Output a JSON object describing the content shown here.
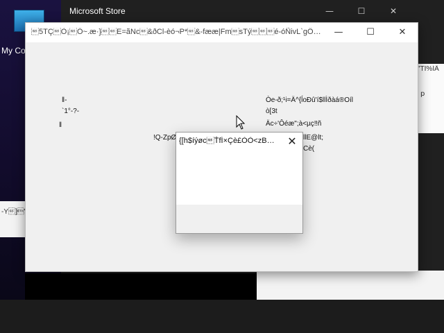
{
  "desktop": {
    "icon_label": "My Co",
    "icon_name": "computer-icon"
  },
  "store_window": {
    "title": "Microsoft Store",
    "right_text_1": "\"TI%ÍÄ",
    "right_text_2": "p",
    "left_text": "-Y\u001d]\u0003\""
  },
  "app_window": {
    "title": "\u001d5TÇ\u001dÒ¡\u001dÖ~.æ·}\u001d\u001dE=ãNc\u001d&ðCl-èó¬P*\u001d&-fææ|Fm\u001dsTý\u001d\u001d\u001dé-óÑivL`gÔ+(!...",
    "left_text_1": "‖-",
    "left_text_2": "`1°-?-",
    "left_text_3": "‖",
    "mid_text": "!Q-ZpØ",
    "right_lines": [
      "Òe-ð;¹i=Ä^{ĺoÐû'í$llÌðàá®Oíl",
      "ò[3t",
      "Äc÷'Ôéæ\";à<µç‼ñ",
      "llE@lt;",
      "Cè("
    ],
    "minimize_label": "—",
    "maximize_label": "☐",
    "close_label": "✕"
  },
  "dialog": {
    "title": "{[h$íýøc\u001dŤfÍ×Çè£ÒÒ<zBä...",
    "close_label": "✕"
  }
}
